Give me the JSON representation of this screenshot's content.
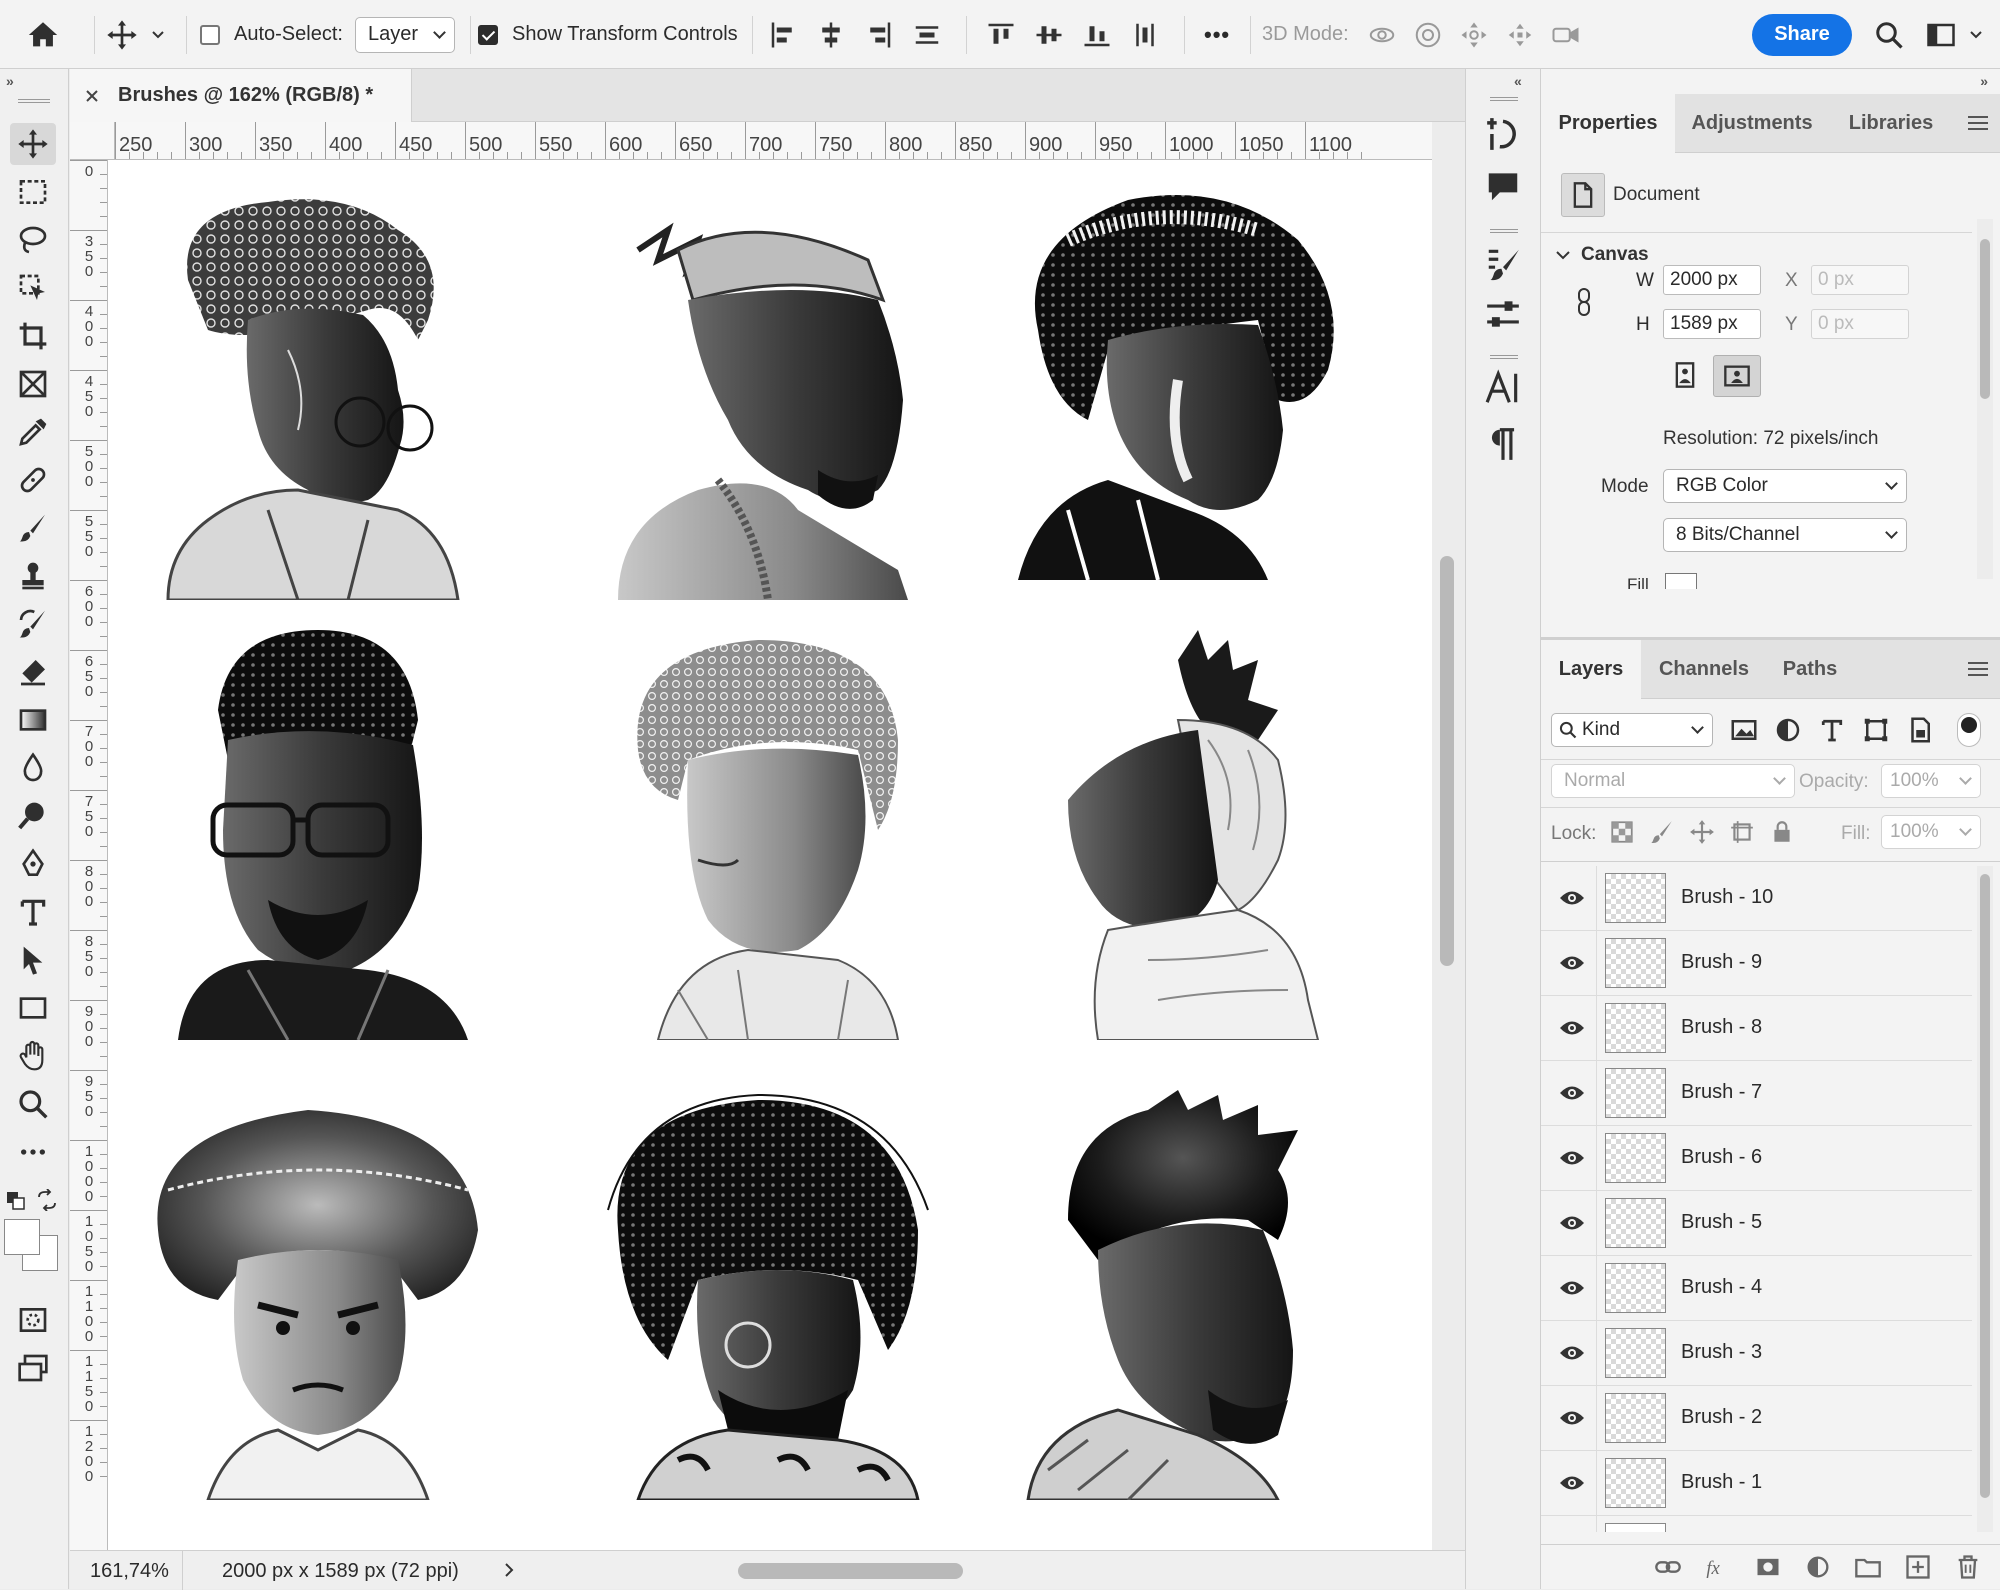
{
  "options_bar": {
    "auto_select_label": "Auto-Select:",
    "auto_select_checked": false,
    "auto_select_target": "Layer",
    "show_transform_label": "Show Transform Controls",
    "show_transform_checked": true,
    "mode_3d_label": "3D Mode:",
    "share_label": "Share",
    "more_glyph": "•••"
  },
  "colors": {
    "share_blue": "#1473e6",
    "panel_bg": "#f3f3f3",
    "toolbar_bg": "#f0f0f0",
    "canvas_bg": "#ffffff"
  },
  "tools": [
    "move-tool",
    "rectangular-marquee-tool",
    "lasso-tool",
    "object-selection-tool",
    "crop-tool",
    "frame-tool",
    "eyedropper-tool",
    "spot-healing-tool",
    "brush-tool",
    "clone-stamp-tool",
    "history-brush-tool",
    "eraser-tool",
    "gradient-tool",
    "blur-tool",
    "dodge-tool",
    "pen-tool",
    "type-tool",
    "path-selection-tool",
    "rectangle-tool",
    "hand-tool",
    "zoom-tool",
    "more-tools"
  ],
  "document": {
    "tab_title": "Brushes @ 162% (RGB/8) *",
    "zoom": "161,74%",
    "info": "2000 px x 1589 px (72 ppi)"
  },
  "ruler": {
    "h_labels": [
      "250",
      "300",
      "350",
      "400",
      "450",
      "500",
      "550",
      "600",
      "650",
      "700",
      "750",
      "800",
      "850",
      "900",
      "950",
      "1000",
      "1050",
      "1100"
    ],
    "v_labels": [
      "0",
      "350",
      "400",
      "450",
      "500",
      "550",
      "600",
      "650",
      "700",
      "750",
      "800",
      "850",
      "900",
      "950",
      "1000",
      "1050",
      "1100",
      "1150",
      "1200"
    ]
  },
  "properties_panel": {
    "tabs": [
      "Properties",
      "Adjustments",
      "Libraries"
    ],
    "active_tab": "Properties",
    "doc_label": "Document",
    "canvas_section": "Canvas",
    "w_label": "W",
    "w_value": "2000 px",
    "h_label": "H",
    "h_value": "1589 px",
    "x_label": "X",
    "x_placeholder": "0 px",
    "y_label": "Y",
    "y_placeholder": "0 px",
    "resolution": "Resolution: 72 pixels/inch",
    "mode_label": "Mode",
    "mode_value": "RGB Color",
    "bits_value": "8 Bits/Channel",
    "fill_label": "Fill"
  },
  "layers_panel": {
    "tabs": [
      "Layers",
      "Channels",
      "Paths"
    ],
    "active_tab": "Layers",
    "filter_kind": "Kind",
    "blend_mode": "Normal",
    "opacity_label": "Opacity:",
    "opacity_value": "100%",
    "lock_label": "Lock:",
    "fill_label": "Fill:",
    "fill_value": "100%",
    "layers": [
      "Brush - 10",
      "Brush - 9",
      "Brush - 8",
      "Brush - 7",
      "Brush - 6",
      "Brush - 5",
      "Brush - 4",
      "Brush - 3",
      "Brush - 2",
      "Brush - 1"
    ]
  }
}
